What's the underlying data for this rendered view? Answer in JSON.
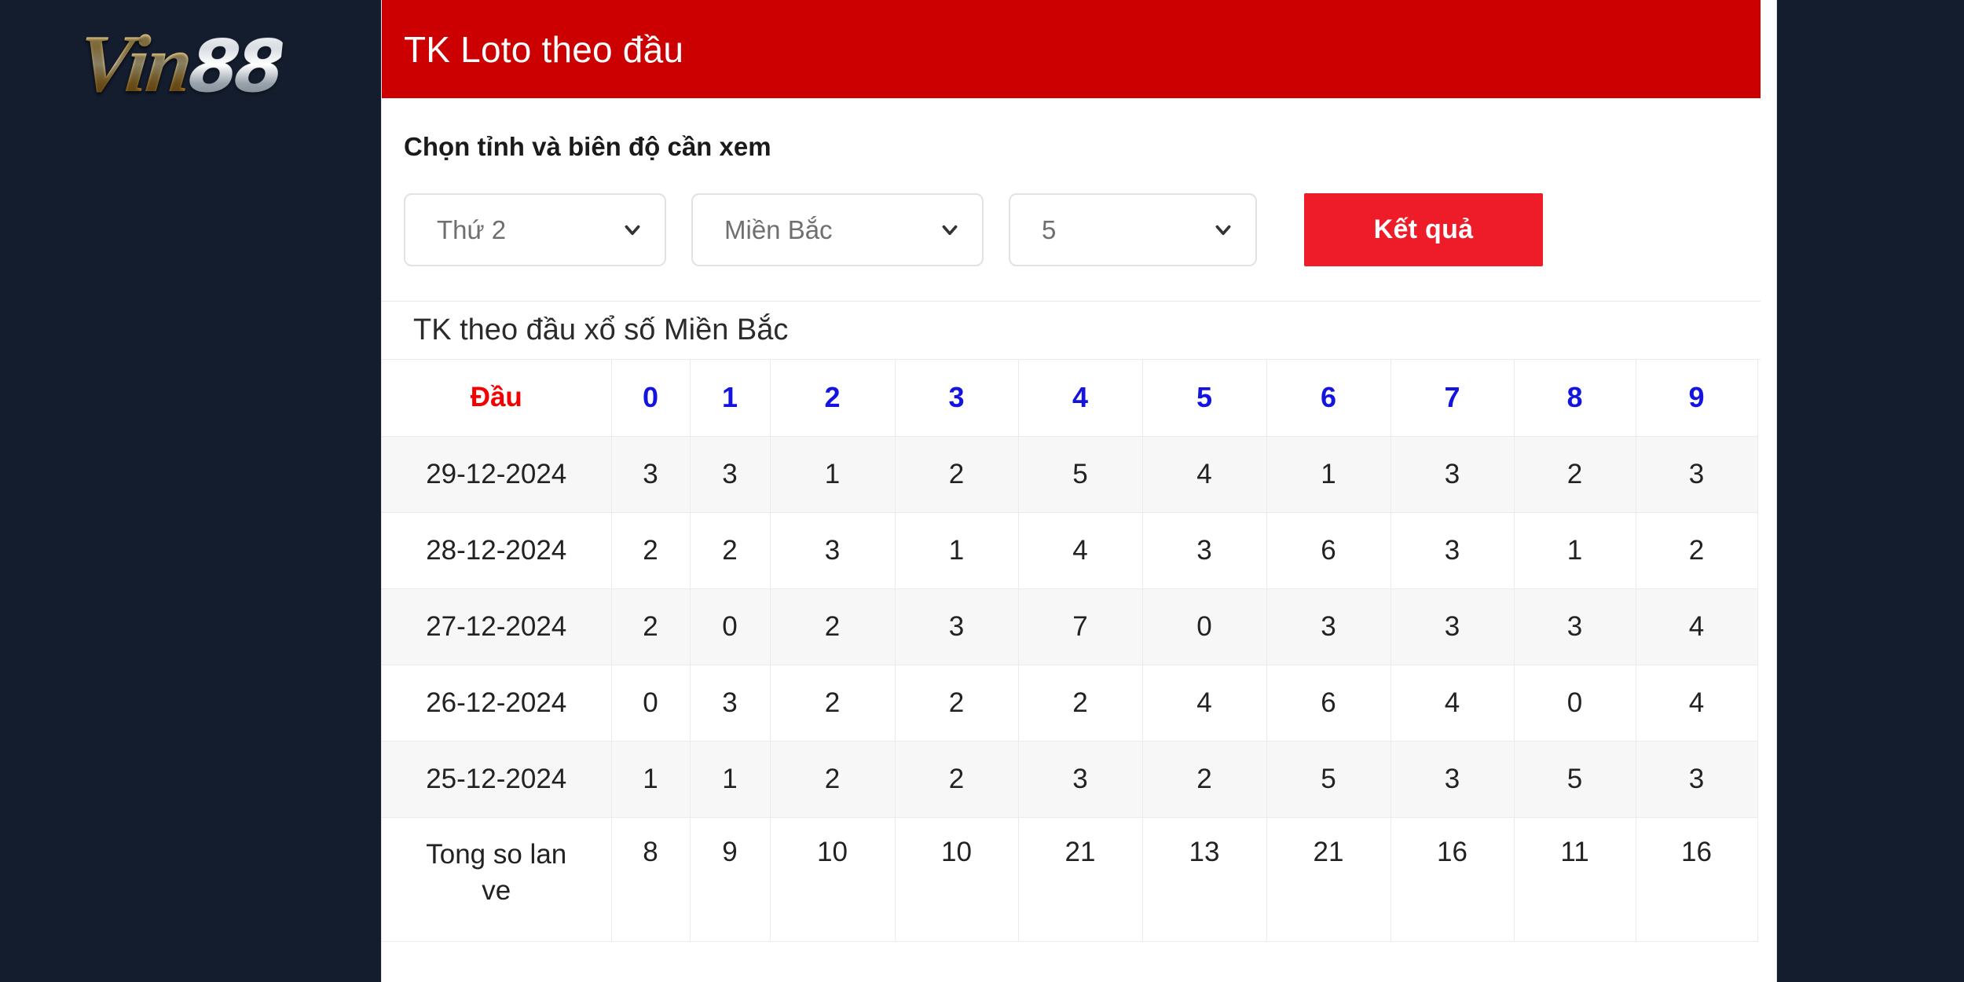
{
  "brand": {
    "logo_gold": "Vin",
    "logo_silver": "88"
  },
  "header": {
    "title": "TK Loto theo đầu"
  },
  "form": {
    "label": "Chọn tỉnh và biên độ cần xem",
    "selects": [
      {
        "name": "day-select",
        "value": "Thứ 2"
      },
      {
        "name": "region-select",
        "value": "Miền Bắc"
      },
      {
        "name": "range-select",
        "value": "5"
      }
    ],
    "submit_label": "Kết quả"
  },
  "table": {
    "title": "TK theo đầu xổ số Miền Bắc",
    "head_label": "Đầu",
    "columns": [
      "0",
      "1",
      "2",
      "3",
      "4",
      "5",
      "6",
      "7",
      "8",
      "9"
    ],
    "rows": [
      {
        "date": "29-12-2024",
        "values": [
          "3",
          "3",
          "1",
          "2",
          "5",
          "4",
          "1",
          "3",
          "2",
          "3"
        ]
      },
      {
        "date": "28-12-2024",
        "values": [
          "2",
          "2",
          "3",
          "1",
          "4",
          "3",
          "6",
          "3",
          "1",
          "2"
        ]
      },
      {
        "date": "27-12-2024",
        "values": [
          "2",
          "0",
          "2",
          "3",
          "7",
          "0",
          "3",
          "3",
          "3",
          "4"
        ]
      },
      {
        "date": "26-12-2024",
        "values": [
          "0",
          "3",
          "2",
          "2",
          "2",
          "4",
          "6",
          "4",
          "0",
          "4"
        ]
      },
      {
        "date": "25-12-2024",
        "values": [
          "1",
          "1",
          "2",
          "2",
          "3",
          "2",
          "5",
          "3",
          "5",
          "3"
        ]
      }
    ],
    "total_label": "Tong so lan ve",
    "totals": [
      "8",
      "9",
      "10",
      "10",
      "21",
      "13",
      "21",
      "16",
      "11",
      "16"
    ]
  },
  "colors": {
    "page_background": "#141d2e",
    "header_red": "#cc0000",
    "button_red": "#ed1c28",
    "head_label_red": "#f40000",
    "column_head_blue": "#1414e0"
  },
  "icons": {
    "chevron": "chevron-down-icon"
  }
}
